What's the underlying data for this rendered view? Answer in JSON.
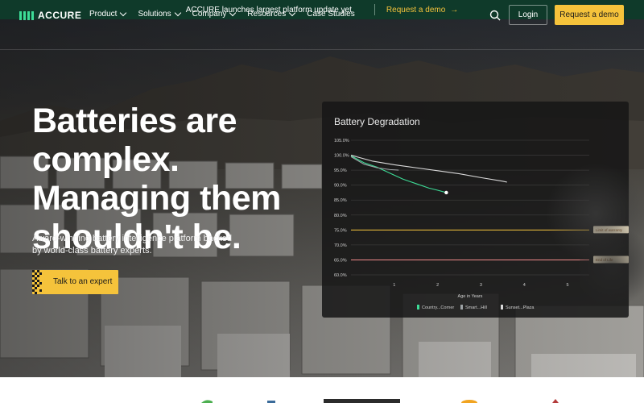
{
  "announcement": {
    "message": "ACCURE launches largest platform update yet",
    "cta_label": "Request a demo",
    "cta_arrow": "→"
  },
  "nav": {
    "logo_text": "ACCURE",
    "items": [
      {
        "label": "Product",
        "has_dropdown": true
      },
      {
        "label": "Solutions",
        "has_dropdown": true
      },
      {
        "label": "Company",
        "has_dropdown": true
      },
      {
        "label": "Resources",
        "has_dropdown": true
      },
      {
        "label": "Case Studies",
        "has_dropdown": false
      }
    ],
    "search_icon": "search-icon",
    "login_label": "Login",
    "demo_label": "Request a demo"
  },
  "hero": {
    "headline": "Batteries are complex. Managing them shouldn't be.",
    "subtitle": "Award-winning battery intelligence platform backed by world-class battery experts.",
    "cta_label": "Talk to an expert"
  },
  "colors": {
    "accent_yellow": "#f5c33b",
    "brand_green": "#3ddc97",
    "announce_bg": "#0f3a2a"
  },
  "chart_data": {
    "type": "line",
    "title": "Battery Degradation",
    "xlabel": "Age in Years",
    "ylabel": "",
    "xlim": [
      0,
      5.5
    ],
    "ylim": [
      60,
      105
    ],
    "x_ticks": [
      1,
      2,
      3,
      4,
      5
    ],
    "y_ticks": [
      "105.0%",
      "100.0%",
      "95.0%",
      "90.0%",
      "85.0%",
      "80.0%",
      "75.0%",
      "70.0%",
      "65.0%",
      "60.0%"
    ],
    "y_tick_values": [
      105,
      100,
      95,
      90,
      85,
      80,
      75,
      70,
      65,
      60
    ],
    "grid": true,
    "legend_position": "bottom",
    "series": [
      {
        "name": "Country...Corner",
        "color": "#3ddc97",
        "x": [
          0,
          0.3,
          0.6,
          0.9,
          1.2,
          1.5,
          1.8,
          2.0,
          2.2
        ],
        "y": [
          99.8,
          97.5,
          96.0,
          94.0,
          92.0,
          90.5,
          89.0,
          88.3,
          87.5
        ]
      },
      {
        "name": "Smart...Hill",
        "color": "#9ea3a6",
        "x": [
          0,
          0.3,
          0.6,
          0.9,
          1.1
        ],
        "y": [
          99.5,
          97.0,
          95.8,
          95.2,
          95.0
        ]
      },
      {
        "name": "Sunset...Plaza",
        "color": "#d9d9d9",
        "x": [
          0,
          0.5,
          1.0,
          1.5,
          2.0,
          2.5,
          3.0,
          3.5,
          3.6
        ],
        "y": [
          100.0,
          98.0,
          96.8,
          95.8,
          94.8,
          93.8,
          92.5,
          91.3,
          91.0
        ]
      }
    ],
    "thresholds": [
      {
        "value": 75,
        "label": "Limit of warranty",
        "color": "#f5c33b"
      },
      {
        "value": 65,
        "label": "End of Life",
        "color": "#f08a8a"
      }
    ]
  }
}
